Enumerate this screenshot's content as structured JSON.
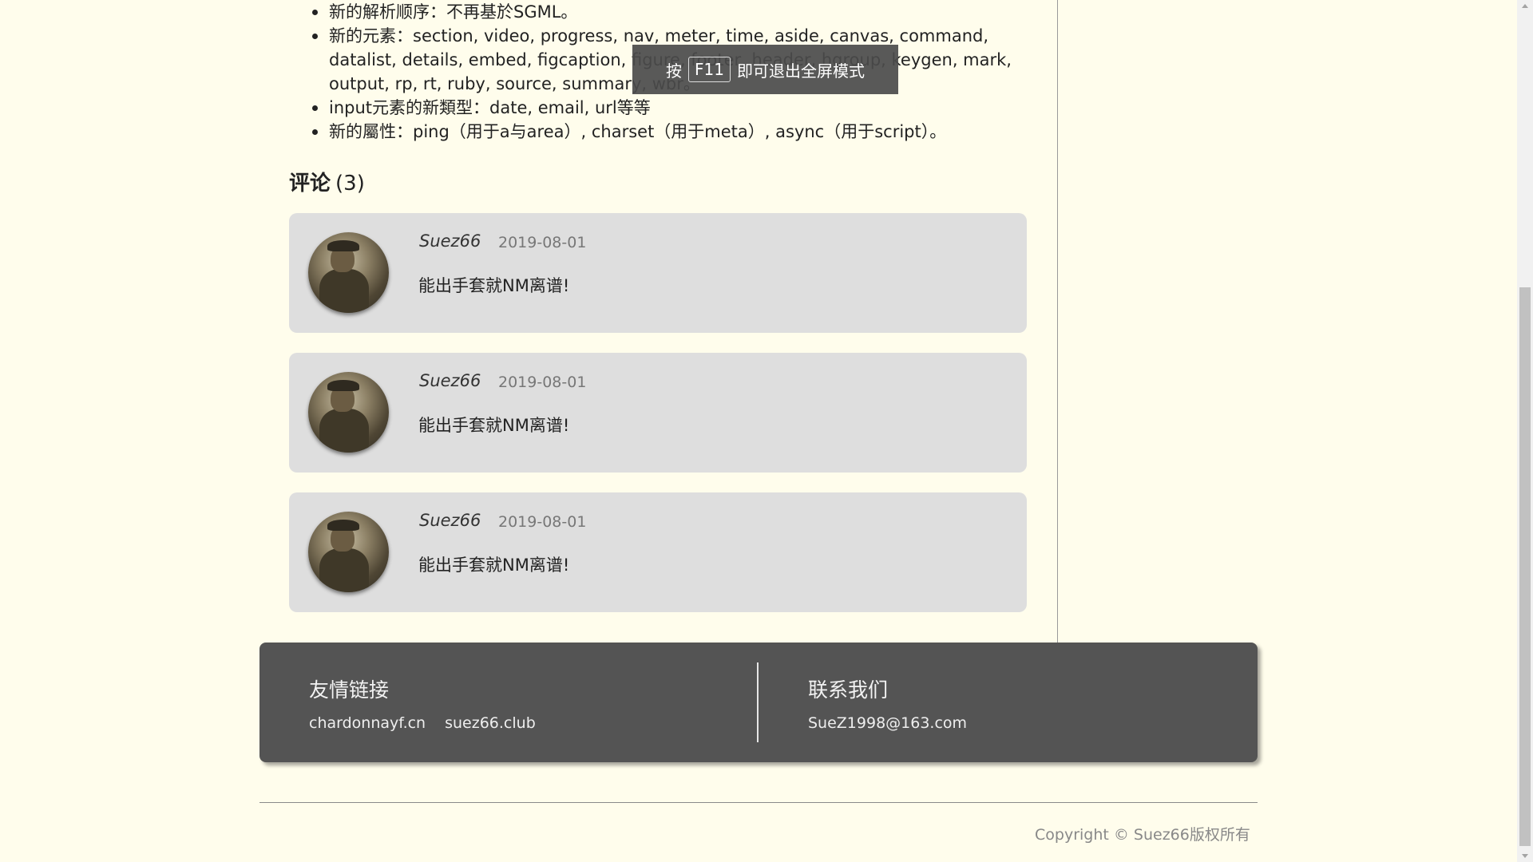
{
  "article": {
    "features": [
      "新的解析顺序：不再基於SGML。",
      "新的元素：section, video, progress, nav, meter, time, aside, canvas, command, datalist, details, embed, figcaption, figure, footer, header, hgroup, keygen, mark, output, rp, rt, ruby, source, summary, wbr。",
      "input元素的新類型：date, email, url等等",
      "新的屬性：ping（用于a与area）, charset（用于meta）, async（用于script）。"
    ]
  },
  "comments": {
    "title": "评论",
    "count": "(3)",
    "items": [
      {
        "author": "Suez66",
        "date": "2019-08-01",
        "text": "能出手套就NM离谱!"
      },
      {
        "author": "Suez66",
        "date": "2019-08-01",
        "text": "能出手套就NM离谱!"
      },
      {
        "author": "Suez66",
        "date": "2019-08-01",
        "text": "能出手套就NM离谱!"
      }
    ]
  },
  "footer": {
    "friend_links_title": "友情链接",
    "links": [
      "chardonnayf.cn",
      "suez66.club"
    ],
    "contact_title": "联系我们",
    "email": "SueZ1998@163.com",
    "copyright": "Copyright © Suez66版权所有"
  },
  "toast": {
    "prefix": "按",
    "key": "F11",
    "suffix": "即可退出全屏模式"
  }
}
